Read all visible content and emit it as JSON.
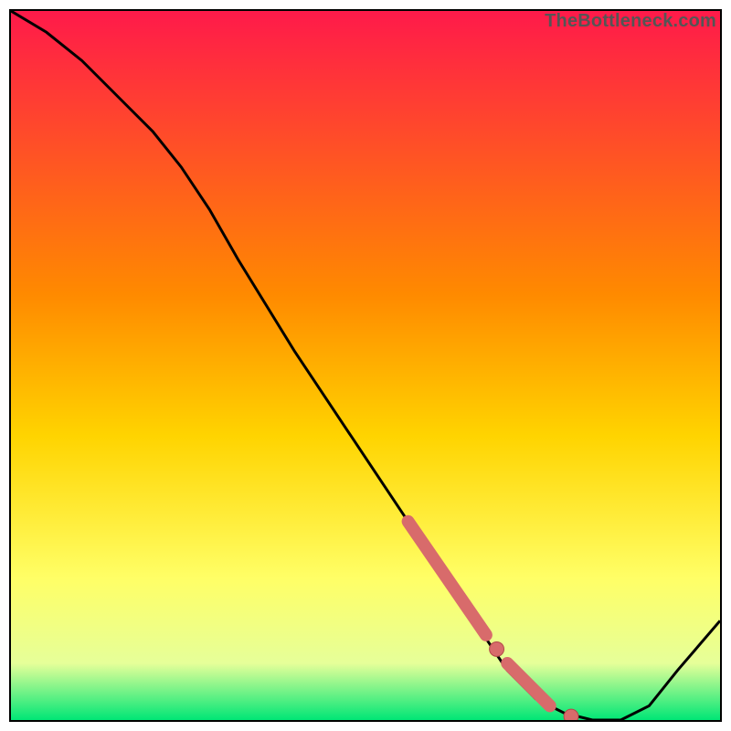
{
  "watermark": "TheBottleneck.com",
  "colors": {
    "top": "#ff1a4a",
    "mid_upper": "#ff8a00",
    "mid": "#ffd400",
    "mid_lower": "#ffff66",
    "bottom_mid": "#e6ff99",
    "bottom": "#00e676",
    "curve_stroke": "#000000",
    "marker_fill": "#d86b6b",
    "marker_stroke": "#b24848"
  },
  "chart_data": {
    "type": "line",
    "title": "",
    "xlabel": "",
    "ylabel": "",
    "xlim": [
      0,
      100
    ],
    "ylim": [
      0,
      100
    ],
    "series": [
      {
        "name": "bottleneck-curve",
        "x": [
          0,
          5,
          10,
          15,
          20,
          24,
          28,
          32,
          40,
          48,
          56,
          60,
          64,
          68,
          70,
          74,
          78,
          82,
          86,
          90,
          94,
          100
        ],
        "y": [
          100,
          97,
          93,
          88,
          83,
          78,
          72,
          65,
          52,
          40,
          28,
          22,
          16,
          10,
          7,
          3,
          1,
          0,
          0,
          2,
          7,
          14
        ]
      }
    ],
    "markers": [
      {
        "name": "highlight-segment",
        "kind": "thick-segment",
        "x0": 56,
        "y0": 28,
        "x1": 67,
        "y1": 12
      },
      {
        "name": "highlight-segment2",
        "kind": "thick-segment",
        "x0": 70,
        "y0": 8,
        "x1": 76,
        "y1": 2
      },
      {
        "name": "dot-mid",
        "kind": "dot",
        "x": 68.5,
        "y": 10
      },
      {
        "name": "dot-trough",
        "kind": "dot",
        "x": 79,
        "y": 0.5
      }
    ],
    "gradient_stops": [
      {
        "offset": 0.0,
        "color_key": "top"
      },
      {
        "offset": 0.4,
        "color_key": "mid_upper"
      },
      {
        "offset": 0.6,
        "color_key": "mid"
      },
      {
        "offset": 0.8,
        "color_key": "mid_lower"
      },
      {
        "offset": 0.92,
        "color_key": "bottom_mid"
      },
      {
        "offset": 1.0,
        "color_key": "bottom"
      }
    ]
  }
}
